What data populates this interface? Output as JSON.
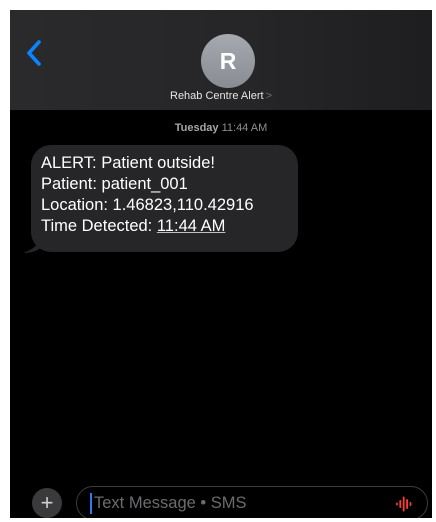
{
  "conversation": {
    "contact_initial": "R",
    "contact_name": "Rehab Centre Alert",
    "contact_chevron": ">"
  },
  "thread": {
    "timestamp_day": "Tuesday",
    "timestamp_time": "11:44 AM",
    "message": {
      "line1": "ALERT: Patient outside!",
      "line2": "Patient: patient_001",
      "line3": "Location: 1.46823,110.42916",
      "line4_prefix": "Time Detected: ",
      "line4_time": "11:44 AM"
    }
  },
  "composer": {
    "placeholder": "Text Message • SMS",
    "plus_label": "+"
  },
  "icons": {
    "back": "chevron-left-icon",
    "add": "plus-icon",
    "audio": "waveform-icon"
  },
  "colors": {
    "accent_blue": "#0a84ff",
    "bubble_gray": "#262629",
    "audio_red": "#ff3b30",
    "cursor_blue": "#2f7bf6"
  }
}
